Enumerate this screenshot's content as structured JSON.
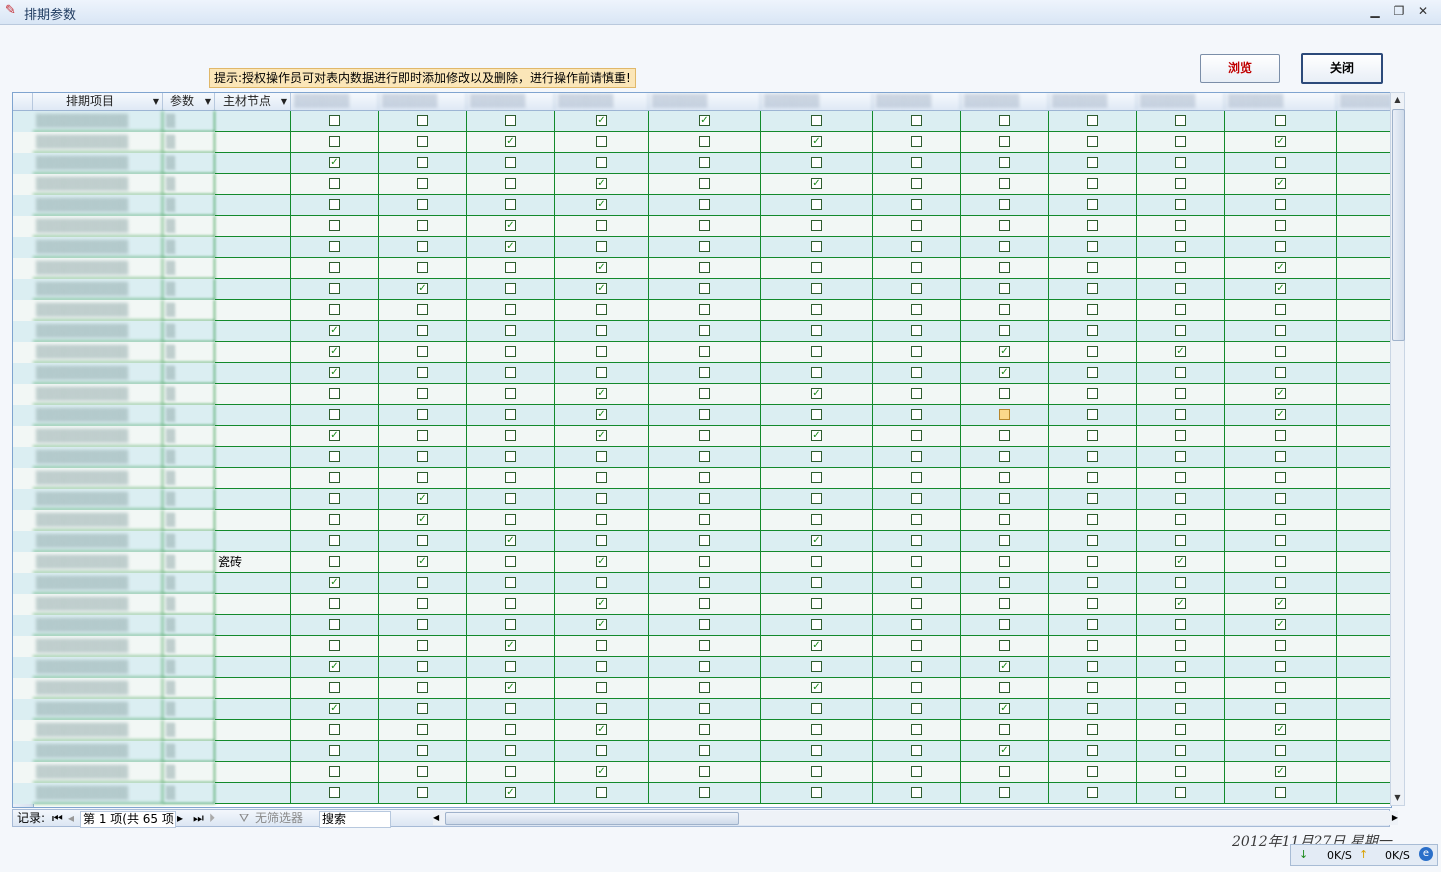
{
  "window": {
    "title": "排期参数",
    "controls": [
      "▁",
      "❐",
      "✕"
    ]
  },
  "hint": "提示:授权操作员可对表内数据进行即时添加修改以及删除，进行操作前请慎重!",
  "buttons": {
    "browse": "浏览",
    "close": "关闭"
  },
  "grid": {
    "headers": [
      "排期项目",
      "参数",
      "主材节点"
    ],
    "blurred_header_placeholder": "▒▒▒▒▒▒",
    "material_node_value": "瓷砖",
    "rows": [
      [
        0,
        0,
        0,
        1,
        1,
        0,
        0,
        0,
        0,
        0,
        0
      ],
      [
        0,
        0,
        1,
        0,
        0,
        1,
        0,
        0,
        0,
        0,
        1
      ],
      [
        1,
        0,
        0,
        0,
        0,
        0,
        0,
        0,
        0,
        0,
        0
      ],
      [
        0,
        0,
        0,
        1,
        0,
        1,
        0,
        0,
        0,
        0,
        1
      ],
      [
        0,
        0,
        0,
        1,
        0,
        0,
        0,
        0,
        0,
        0,
        0
      ],
      [
        0,
        0,
        1,
        0,
        0,
        0,
        0,
        0,
        0,
        0,
        0
      ],
      [
        0,
        0,
        1,
        0,
        0,
        0,
        0,
        0,
        0,
        0,
        0
      ],
      [
        0,
        0,
        0,
        1,
        0,
        0,
        0,
        0,
        0,
        0,
        1
      ],
      [
        0,
        1,
        0,
        1,
        0,
        0,
        0,
        0,
        0,
        0,
        1
      ],
      [
        0,
        0,
        0,
        0,
        0,
        0,
        0,
        0,
        0,
        0,
        0
      ],
      [
        1,
        0,
        0,
        0,
        0,
        0,
        0,
        0,
        0,
        0,
        0
      ],
      [
        1,
        0,
        0,
        0,
        0,
        0,
        0,
        1,
        0,
        1,
        0
      ],
      [
        1,
        0,
        0,
        0,
        0,
        0,
        0,
        1,
        0,
        0,
        0
      ],
      [
        0,
        0,
        0,
        1,
        0,
        1,
        0,
        0,
        0,
        0,
        1
      ],
      [
        0,
        0,
        0,
        1,
        0,
        0,
        0,
        2,
        0,
        0,
        1
      ],
      [
        1,
        0,
        0,
        1,
        0,
        1,
        0,
        0,
        0,
        0,
        0
      ],
      [
        0,
        0,
        0,
        0,
        0,
        0,
        0,
        0,
        0,
        0,
        0
      ],
      [
        0,
        0,
        0,
        0,
        0,
        0,
        0,
        0,
        0,
        0,
        0
      ],
      [
        0,
        1,
        0,
        0,
        0,
        0,
        0,
        0,
        0,
        0,
        0
      ],
      [
        0,
        1,
        0,
        0,
        0,
        0,
        0,
        0,
        0,
        0,
        0
      ],
      [
        0,
        0,
        1,
        0,
        0,
        1,
        0,
        0,
        0,
        0,
        0
      ],
      [
        0,
        1,
        0,
        1,
        0,
        0,
        0,
        0,
        0,
        1,
        0
      ],
      [
        1,
        0,
        0,
        0,
        0,
        0,
        0,
        0,
        0,
        0,
        0
      ],
      [
        0,
        0,
        0,
        1,
        0,
        0,
        0,
        0,
        0,
        1,
        1
      ],
      [
        0,
        0,
        0,
        1,
        0,
        0,
        0,
        0,
        0,
        0,
        1
      ],
      [
        0,
        0,
        1,
        0,
        0,
        1,
        0,
        0,
        0,
        0,
        0
      ],
      [
        1,
        0,
        0,
        0,
        0,
        0,
        0,
        1,
        0,
        0,
        0
      ],
      [
        0,
        0,
        1,
        0,
        0,
        1,
        0,
        0,
        0,
        0,
        0
      ],
      [
        1,
        0,
        0,
        0,
        0,
        0,
        0,
        1,
        0,
        0,
        0
      ],
      [
        0,
        0,
        0,
        1,
        0,
        0,
        0,
        0,
        0,
        0,
        1
      ],
      [
        0,
        0,
        0,
        0,
        0,
        0,
        0,
        1,
        0,
        0,
        0
      ],
      [
        0,
        0,
        0,
        1,
        0,
        0,
        0,
        0,
        0,
        0,
        1
      ],
      [
        0,
        0,
        1,
        0,
        0,
        0,
        0,
        0,
        0,
        0,
        0
      ]
    ],
    "material_row_index": 21
  },
  "navigator": {
    "record_label": "记录:",
    "position": "第 1 项(共 65 项",
    "filter": "无筛选器",
    "search": "搜索"
  },
  "status": {
    "date": "2012年11月27日 星期一",
    "down": "0K/S",
    "up": "0K/S"
  },
  "colors": {
    "row_odd": "#dbeef2",
    "row_even": "#f2f7f5",
    "grid_line": "#138a2c",
    "check": "#1a8a1a",
    "hint_bg": "#fbe6b8"
  }
}
